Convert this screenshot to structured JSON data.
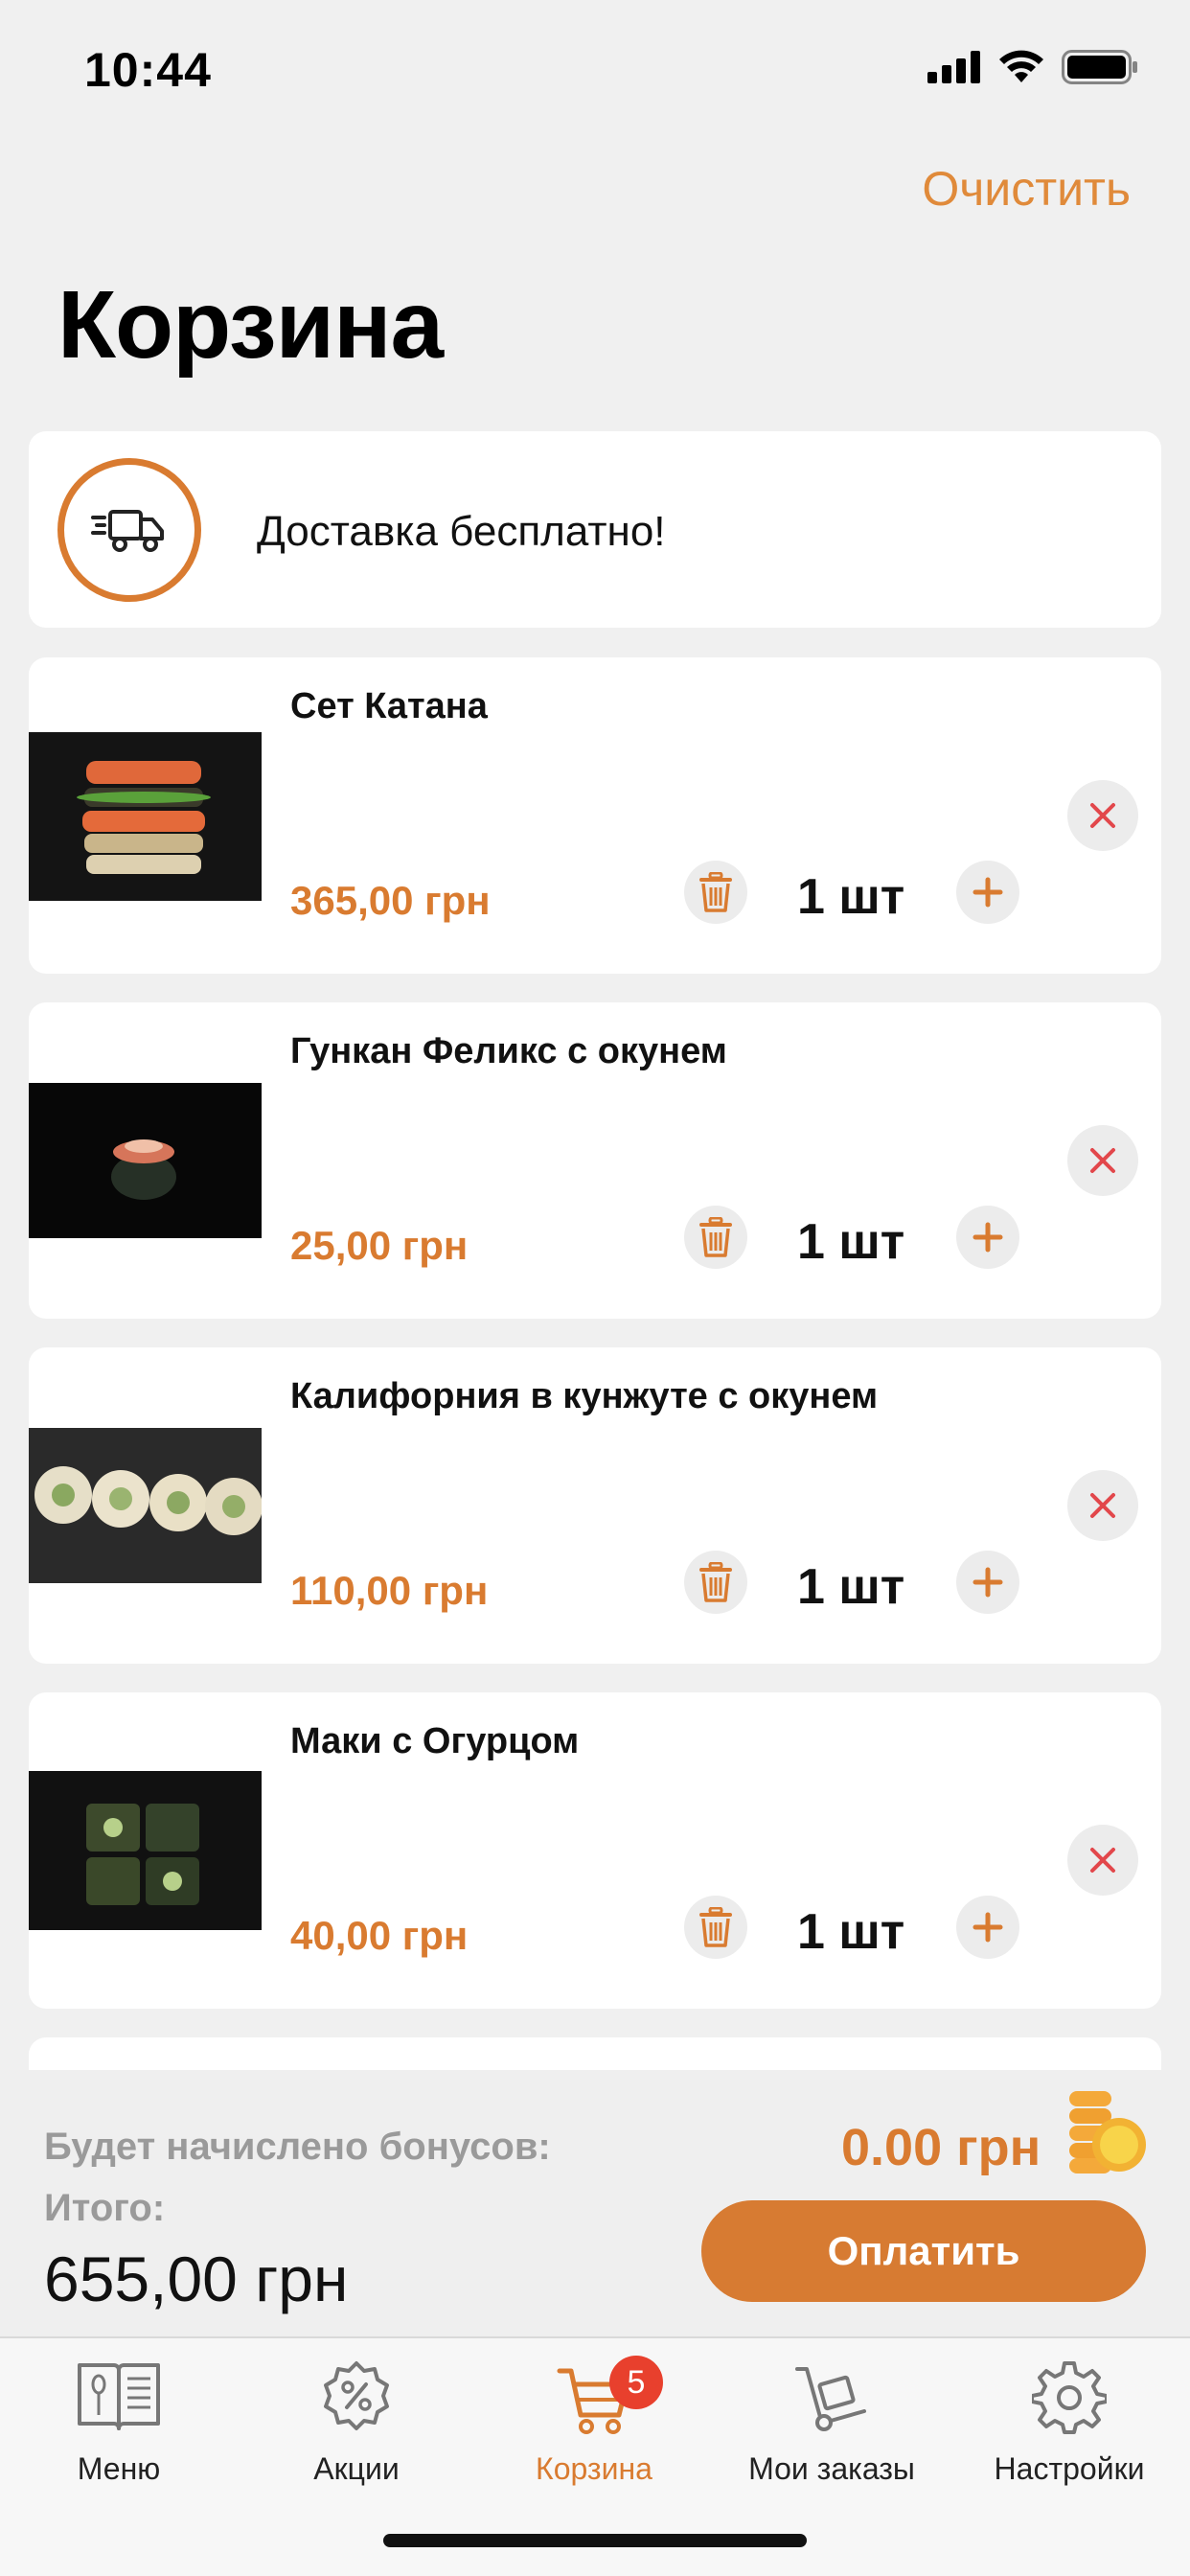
{
  "status_bar": {
    "time": "10:44"
  },
  "header": {
    "clear_label": "Очистить",
    "title": "Корзина"
  },
  "delivery": {
    "text": "Доставка бесплатно!",
    "icon": "truck-icon"
  },
  "cart_items": [
    {
      "name": "Сет Катана",
      "price": "365,00 грн",
      "quantity": "1 шт"
    },
    {
      "name": "Гункан Феликс с окунем",
      "price": "25,00 грн",
      "quantity": "1 шт"
    },
    {
      "name": "Калифорния в кунжуте с окунем",
      "price": "110,00 грн",
      "quantity": "1 шт"
    },
    {
      "name": "Маки с Огурцом",
      "price": "40,00 грн",
      "quantity": "1 шт"
    }
  ],
  "summary": {
    "bonus_label": "Будет начислено бонусов:",
    "bonus_value": "0.00 грн",
    "total_label": "Итого:",
    "total_value": "655,00 грн",
    "pay_label": "Оплатить"
  },
  "tabbar": {
    "tabs": [
      {
        "label": "Меню",
        "icon": "menu-book-icon"
      },
      {
        "label": "Акции",
        "icon": "discount-icon"
      },
      {
        "label": "Корзина",
        "icon": "cart-icon",
        "badge": "5"
      },
      {
        "label": "Мои заказы",
        "icon": "dolly-icon"
      },
      {
        "label": "Настройки",
        "icon": "gear-icon"
      }
    ],
    "active_index": 2
  },
  "colors": {
    "accent": "#d97b30",
    "badge": "#e8402d",
    "remove": "#e2474b"
  }
}
